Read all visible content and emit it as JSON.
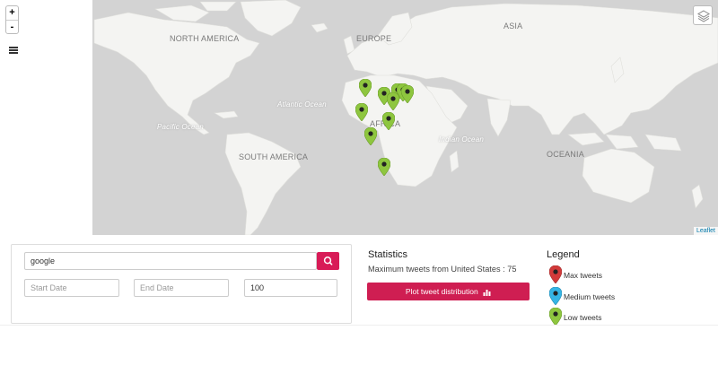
{
  "map": {
    "zoom_in": "+",
    "zoom_out": "-",
    "attribution": "Leaflet",
    "labels": {
      "north_america": "NORTH AMERICA",
      "south_america": "SOUTH AMERICA",
      "europe": "EUROPE",
      "asia": "ASIA",
      "africa": "AFRICA",
      "oceania": "OCEANIA",
      "atlantic": "Atlantic Ocean",
      "pacific": "Pacific Ocean",
      "indian": "Indian Ocean"
    },
    "marker_colors": {
      "max": "#d23a3a",
      "medium": "#35b5e5",
      "low": "#8ec63f"
    }
  },
  "search": {
    "query": "google",
    "start_placeholder": "Start Date",
    "end_placeholder": "End Date",
    "limit": "100"
  },
  "stats": {
    "title": "Statistics",
    "text": "Maximum tweets from United States : 75",
    "plot_button": "Plot tweet distribution"
  },
  "legend": {
    "title": "Legend",
    "items": [
      {
        "label": "Max tweets",
        "color": "#d23a3a"
      },
      {
        "label": "Medium tweets",
        "color": "#35b5e5"
      },
      {
        "label": "Low tweets",
        "color": "#8ec63f"
      }
    ]
  }
}
